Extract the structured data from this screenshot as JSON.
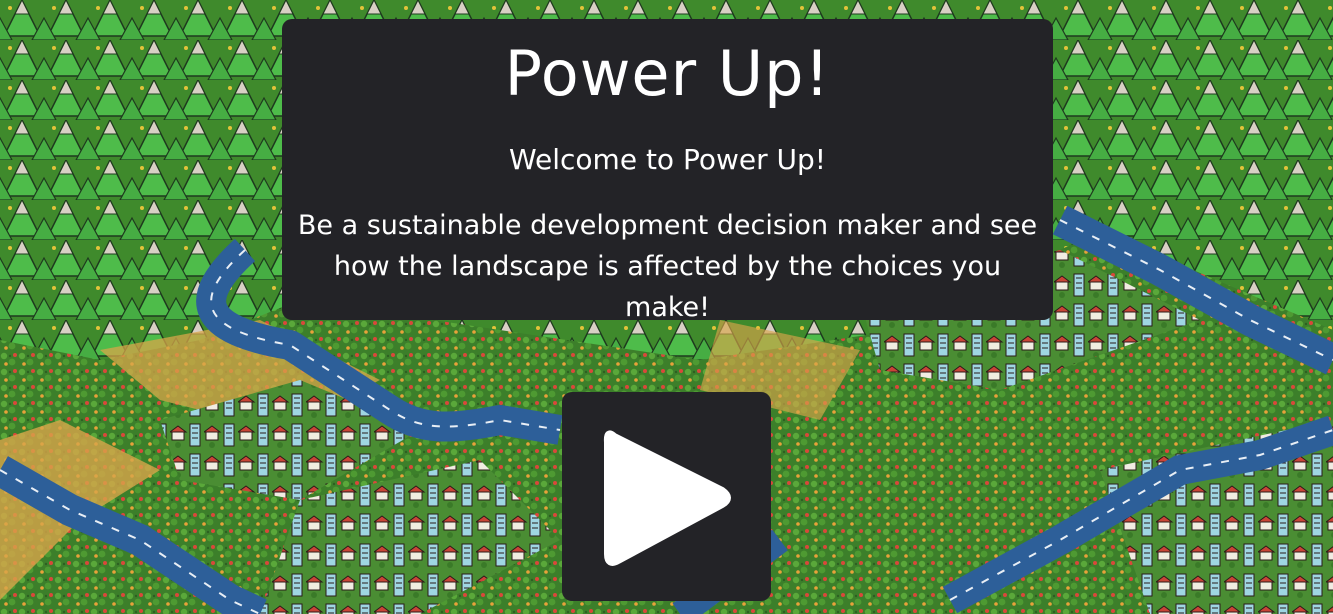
{
  "game": {
    "title": "Power Up!",
    "welcome": "Welcome to Power Up!",
    "description": "Be a sustainable development decision maker and see how the landscape is affected by the choices you make!"
  },
  "play_button": {
    "icon": "play-icon"
  },
  "colors": {
    "panel": "#232327",
    "text": "#ffffff",
    "forest": "#3f8f2f",
    "mountain_green": "#4cbb4c",
    "river": "#2f5f9a",
    "sand": "#d9a84a"
  }
}
